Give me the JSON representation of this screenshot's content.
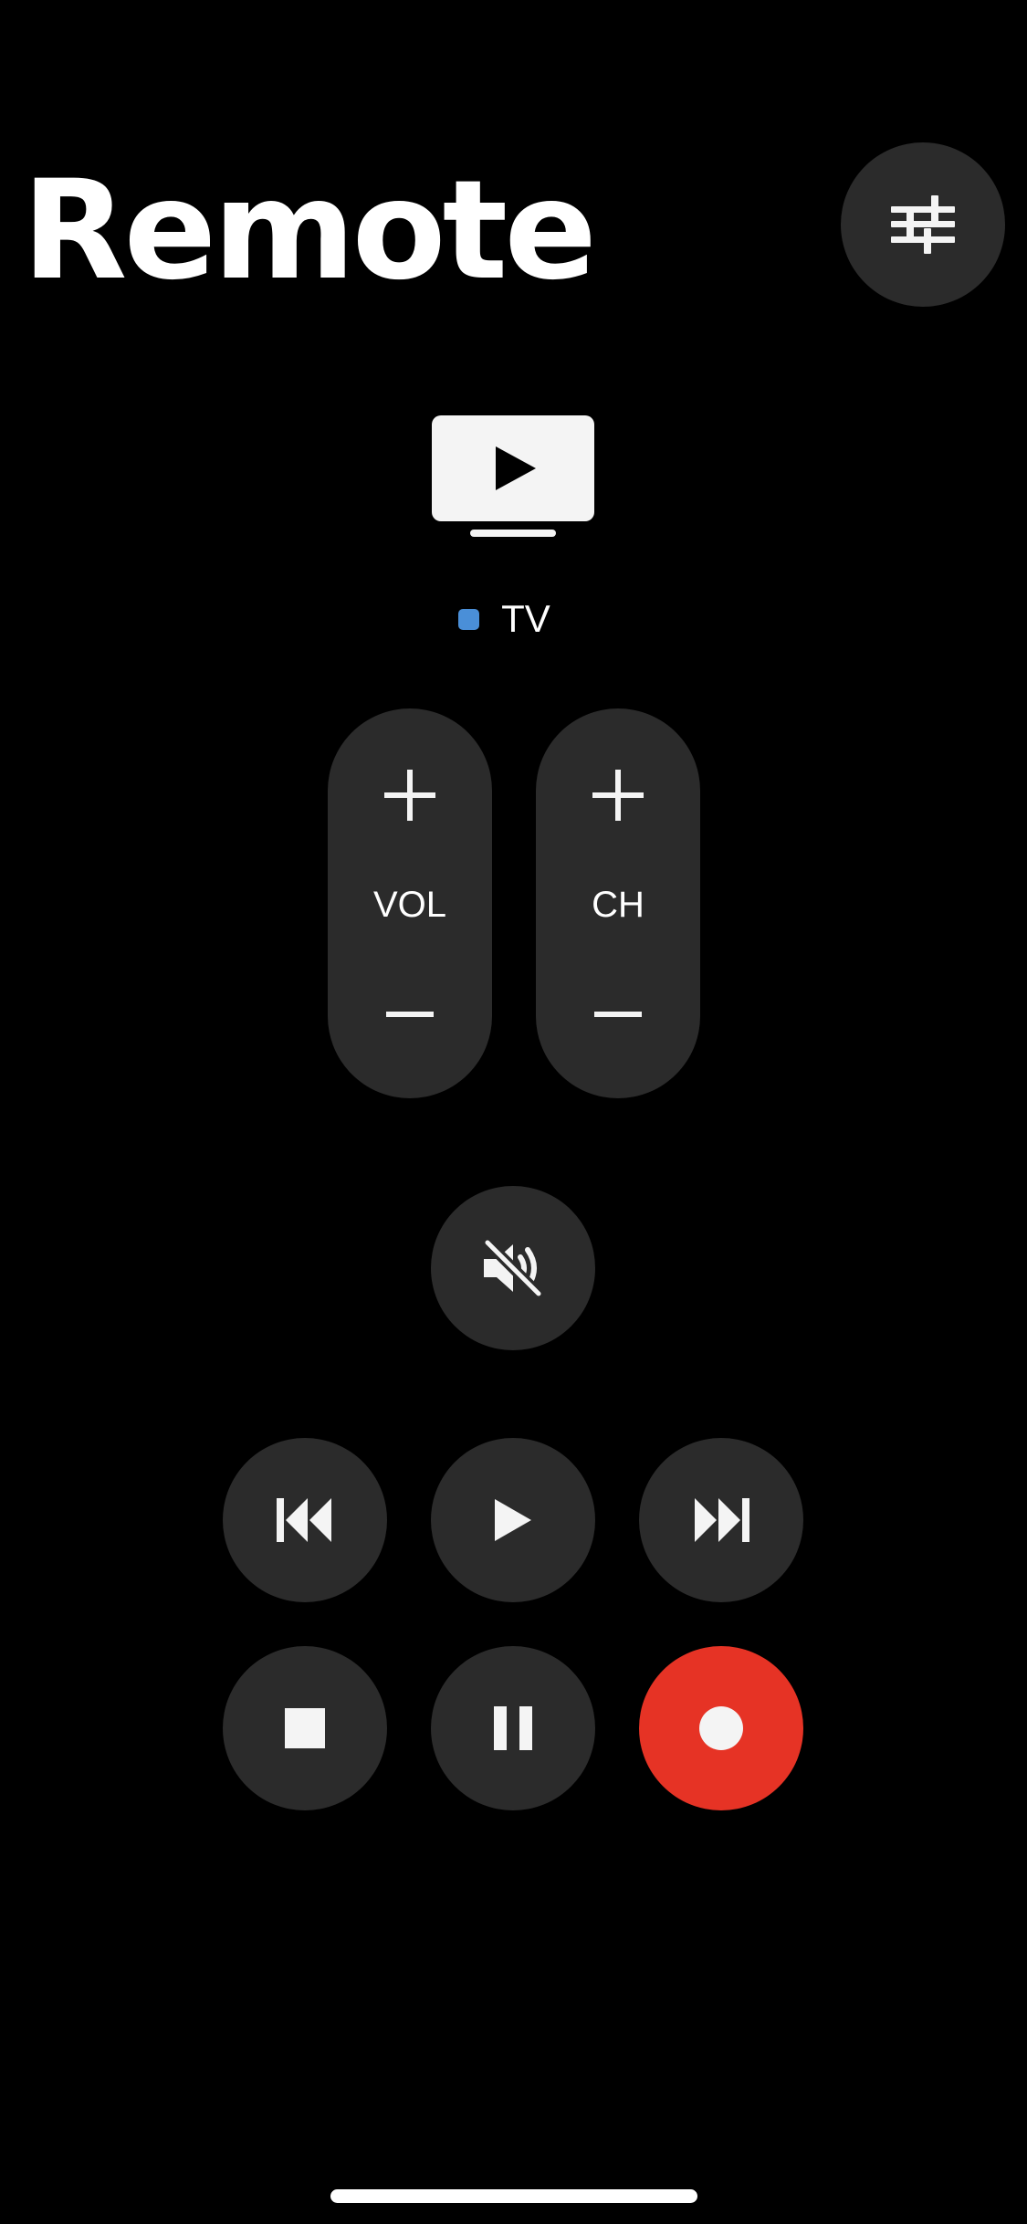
{
  "header": {
    "title": "Remote"
  },
  "device": {
    "name": "TV",
    "status_color": "#4a8fd8"
  },
  "controls": {
    "volume_label": "VOL",
    "channel_label": "CH"
  },
  "colors": {
    "background": "#000000",
    "button": "#2b2b2b",
    "icon": "#f4f4f4",
    "record": "#e63325"
  },
  "icons": {
    "settings": "sliders-icon",
    "device": "tv-play-icon",
    "mute": "speaker-muted-icon",
    "previous": "skip-back-icon",
    "play": "play-icon",
    "next": "skip-forward-icon",
    "stop": "stop-icon",
    "pause": "pause-icon",
    "record": "record-icon"
  }
}
